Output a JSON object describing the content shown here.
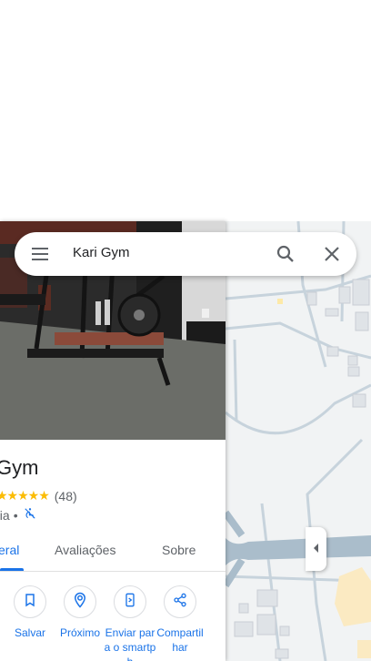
{
  "search": {
    "query": "Kari Gym"
  },
  "place": {
    "name": "Gym",
    "stars": "★★★★★",
    "review_count": "(48)",
    "category": "nia",
    "separator": "•"
  },
  "tabs": [
    {
      "label": "eral",
      "active": true
    },
    {
      "label": "Avaliações",
      "active": false
    },
    {
      "label": "Sobre",
      "active": false
    }
  ],
  "actions": [
    {
      "label": "Salvar",
      "icon": "bookmark-icon"
    },
    {
      "label": "Próximo",
      "icon": "nearby-icon"
    },
    {
      "label": "Enviar para o smartph",
      "icon": "send-to-phone-icon"
    },
    {
      "label": "Compartilhar",
      "icon": "share-icon"
    }
  ],
  "colors": {
    "accent": "#1a73e8",
    "star": "#fbbc04",
    "map_background": "#f1f3f4",
    "map_roads": "#aabdcb"
  }
}
